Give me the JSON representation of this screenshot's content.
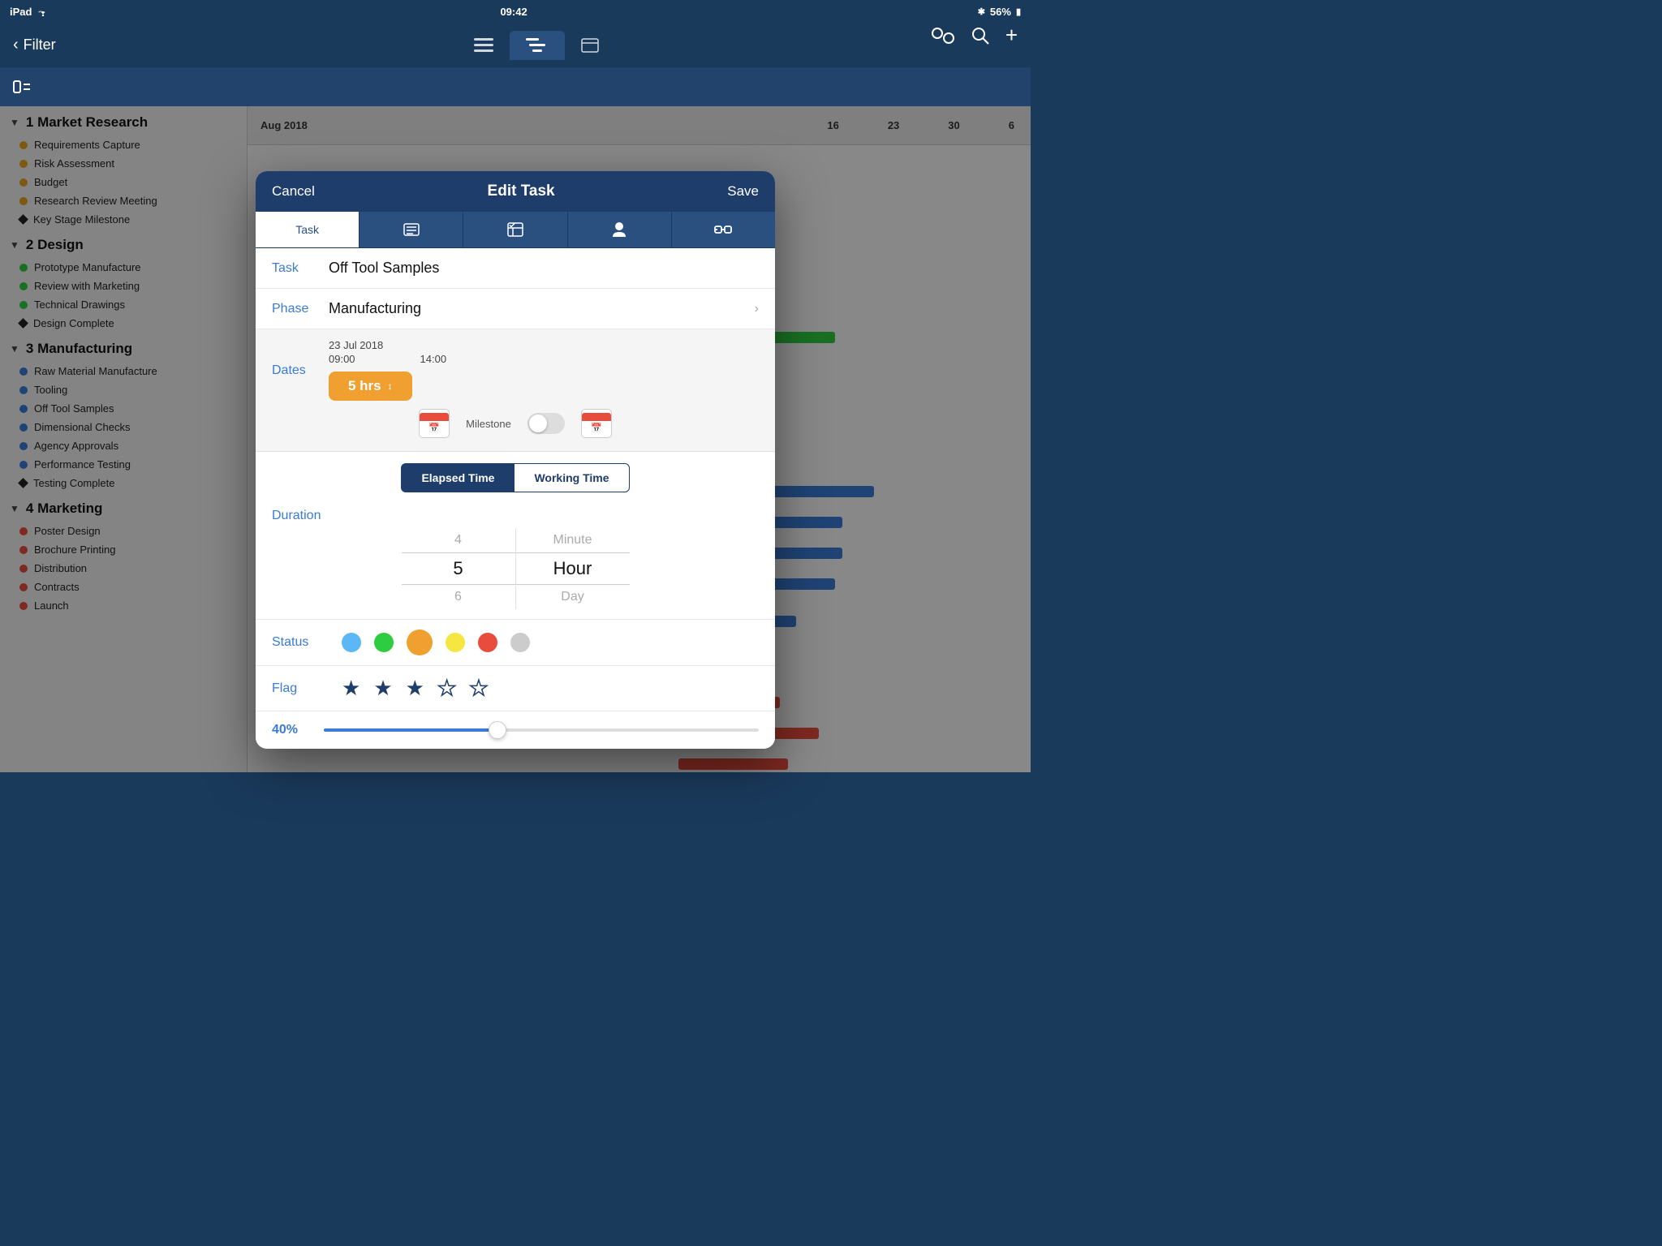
{
  "status_bar": {
    "device": "iPad",
    "wifi_icon": "wifi",
    "time": "09:42",
    "bluetooth_icon": "bluetooth",
    "battery": "56%"
  },
  "toolbar": {
    "filter_label": "Filter",
    "tabs": [
      {
        "id": "list",
        "label": "list-view",
        "active": false
      },
      {
        "id": "gantt",
        "label": "gantt-view",
        "active": true
      },
      {
        "id": "board",
        "label": "board-view",
        "active": false
      }
    ],
    "add_label": "+"
  },
  "second_toolbar": {
    "menu_icon": "menu",
    "settings_icon": "settings",
    "search_icon": "search"
  },
  "sidebar": {
    "phases": [
      {
        "id": "1",
        "number": "1",
        "name": "Market Research",
        "tasks": [
          {
            "name": "Requirements Capture",
            "color": "#e8a020",
            "type": "dot"
          },
          {
            "name": "Risk Assessment",
            "color": "#e8a020",
            "type": "dot"
          },
          {
            "name": "Budget",
            "color": "#e8a020",
            "type": "dot"
          },
          {
            "name": "Research Review Meeting",
            "color": "#e8a020",
            "type": "dot"
          },
          {
            "name": "Key Stage Milestone",
            "color": "#222",
            "type": "diamond"
          }
        ]
      },
      {
        "id": "2",
        "number": "2",
        "name": "Design",
        "tasks": [
          {
            "name": "Prototype Manufacture",
            "color": "#2ecc40",
            "type": "dot"
          },
          {
            "name": "Review with Marketing",
            "color": "#2ecc40",
            "type": "dot"
          },
          {
            "name": "Technical Drawings",
            "color": "#2ecc40",
            "type": "dot"
          },
          {
            "name": "Design Complete",
            "color": "#222",
            "type": "diamond"
          }
        ]
      },
      {
        "id": "3",
        "number": "3",
        "name": "Manufacturing",
        "tasks": [
          {
            "name": "Raw Material Manufacture",
            "color": "#3a7bd5",
            "type": "dot"
          },
          {
            "name": "Tooling",
            "color": "#3a7bd5",
            "type": "dot"
          },
          {
            "name": "Off Tool Samples",
            "color": "#3a7bd5",
            "type": "dot"
          },
          {
            "name": "Dimensional Checks",
            "color": "#3a7bd5",
            "type": "dot"
          },
          {
            "name": "Agency Approvals",
            "color": "#3a7bd5",
            "type": "dot"
          },
          {
            "name": "Performance Testing",
            "color": "#3a7bd5",
            "type": "dot"
          },
          {
            "name": "Testing Complete",
            "color": "#222",
            "type": "diamond"
          }
        ]
      },
      {
        "id": "4",
        "number": "4",
        "name": "Marketing",
        "tasks": [
          {
            "name": "Poster Design",
            "color": "#e74c3c",
            "type": "dot"
          },
          {
            "name": "Brochure Printing",
            "color": "#e74c3c",
            "type": "dot"
          },
          {
            "name": "Distribution",
            "color": "#e74c3c",
            "type": "dot"
          },
          {
            "name": "Contracts",
            "color": "#e74c3c",
            "type": "dot"
          },
          {
            "name": "Launch",
            "color": "#e74c3c",
            "type": "dot"
          }
        ]
      }
    ]
  },
  "gantt": {
    "month": "Aug 2018",
    "columns": [
      "16",
      "23",
      "30",
      "6"
    ]
  },
  "modal": {
    "title": "Edit Task",
    "cancel_label": "Cancel",
    "save_label": "Save",
    "tabs": [
      {
        "id": "task",
        "label": "Task",
        "active": true
      },
      {
        "id": "notes",
        "label": "notes-icon"
      },
      {
        "id": "checklist",
        "label": "checklist-icon"
      },
      {
        "id": "person",
        "label": "person-icon"
      },
      {
        "id": "link",
        "label": "link-icon"
      }
    ],
    "task_field": {
      "label": "Task",
      "value": "Off Tool Samples"
    },
    "phase_field": {
      "label": "Phase",
      "value": "Manufacturing"
    },
    "dates": {
      "label": "Dates",
      "date": "23 Jul 2018",
      "start_time": "09:00",
      "end_time": "14:00",
      "duration_label": "5 hrs",
      "milestone_label": "Milestone",
      "milestone_on": false
    },
    "time_toggle": {
      "elapsed_label": "Elapsed Time",
      "working_label": "Working Time",
      "active": "elapsed"
    },
    "duration": {
      "label": "Duration",
      "values_num": [
        "4",
        "5",
        "6"
      ],
      "values_unit": [
        "Minute",
        "Hour",
        "Day"
      ],
      "selected_num": "5",
      "selected_unit": "Hour"
    },
    "status": {
      "label": "Status",
      "options": [
        {
          "color": "#5bb8f5",
          "selected": false
        },
        {
          "color": "#2ecc40",
          "selected": false
        },
        {
          "color": "#f0a030",
          "selected": true
        },
        {
          "color": "#f5e642",
          "selected": false
        },
        {
          "color": "#e74c3c",
          "selected": false
        },
        {
          "color": "#cccccc",
          "selected": false
        }
      ]
    },
    "flag": {
      "label": "Flag",
      "stars": [
        {
          "filled": true,
          "level": 5
        },
        {
          "filled": true,
          "level": 4
        },
        {
          "filled": true,
          "level": 3
        },
        {
          "filled": false,
          "level": 2
        },
        {
          "filled": false,
          "level": 1
        }
      ]
    },
    "progress": {
      "value": 40,
      "label": "40%"
    }
  }
}
